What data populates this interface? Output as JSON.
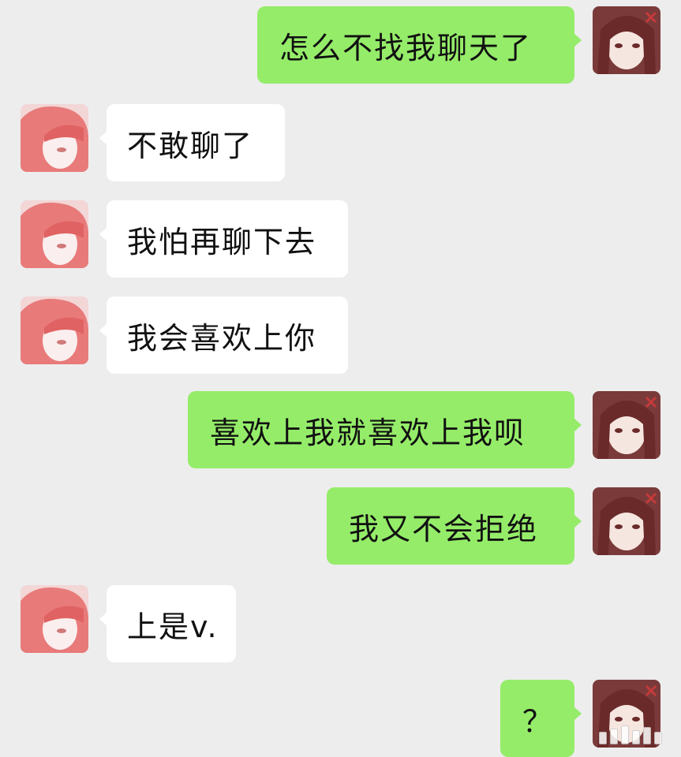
{
  "messages": [
    {
      "side": "right",
      "text": "怎么不找我聊天了"
    },
    {
      "side": "left",
      "text": "不敢聊了"
    },
    {
      "side": "left",
      "text": "我怕再聊下去"
    },
    {
      "side": "left",
      "text": "我会喜欢上你"
    },
    {
      "side": "right",
      "text": "喜欢上我就喜欢上我呗"
    },
    {
      "side": "right",
      "text": "我又不会拒绝"
    },
    {
      "side": "left",
      "text": "上是v."
    },
    {
      "side": "right",
      "text": "？"
    }
  ],
  "colors": {
    "background": "#ededed",
    "self_bubble": "#95ec69",
    "other_bubble": "#ffffff"
  },
  "icons": {
    "self_avatar": "anime-girl-avatar-icon",
    "other_avatar": "pink-hair-avatar-icon"
  }
}
